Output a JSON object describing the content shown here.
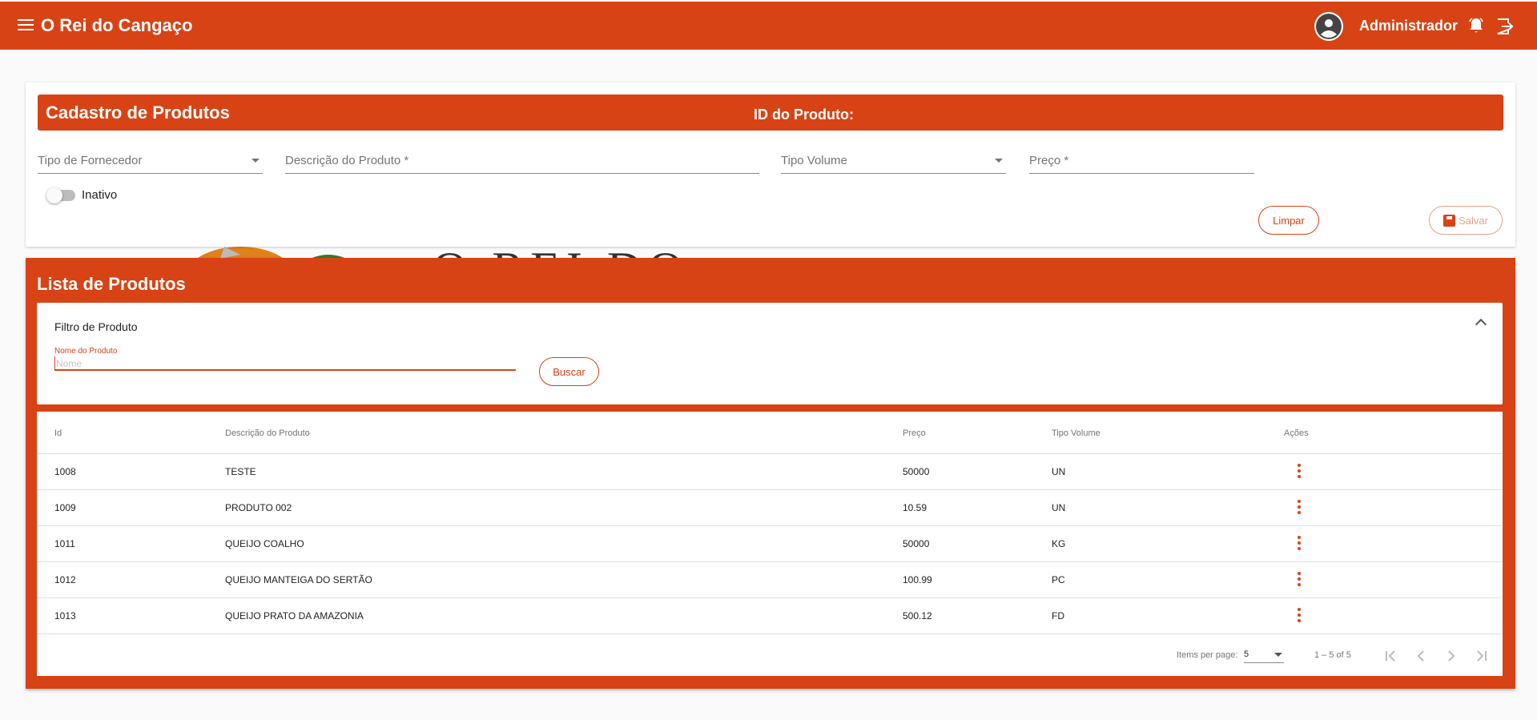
{
  "app": {
    "title": "O Rei do Cangaço",
    "user_name": "Administrador",
    "watermark_text": "O REI DO"
  },
  "form": {
    "title": "Cadastro de Produtos",
    "id_label": "ID do Produto:",
    "fields": {
      "supplier_type": "Tipo de Fornecedor",
      "description": "Descrição do Produto *",
      "volume_type": "Tipo Volume",
      "price": "Preço *"
    },
    "toggle_label": "Inativo",
    "clear_label": "Limpar",
    "save_label": "Salvar"
  },
  "list": {
    "title": "Lista de Produtos",
    "filter": {
      "title": "Filtro de Produto",
      "name_label": "Nome do Produto",
      "name_placeholder": "Nome",
      "search_label": "Buscar"
    },
    "columns": {
      "id": "Id",
      "description": "Descrição do Produto",
      "price": "Preço",
      "volume": "Tipo Volume",
      "actions": "Ações"
    },
    "rows": [
      {
        "id": "1008",
        "description": "TESTE",
        "price": "50000",
        "volume": "UN"
      },
      {
        "id": "1009",
        "description": "PRODUTO 002",
        "price": "10.59",
        "volume": "UN"
      },
      {
        "id": "1011",
        "description": "QUEIJO COALHO",
        "price": "50000",
        "volume": "KG"
      },
      {
        "id": "1012",
        "description": "QUEIJO MANTEIGA DO SERTÃO",
        "price": "100.99",
        "volume": "PC"
      },
      {
        "id": "1013",
        "description": "QUEIJO PRATO DA AMAZONIA",
        "price": "500.12",
        "volume": "FD"
      }
    ],
    "paginator": {
      "items_per_page_label": "Items per page:",
      "page_size": "5",
      "range_label": "1 – 5 of 5"
    }
  },
  "colors": {
    "primary": "#d84315",
    "background": "#fafafa"
  }
}
